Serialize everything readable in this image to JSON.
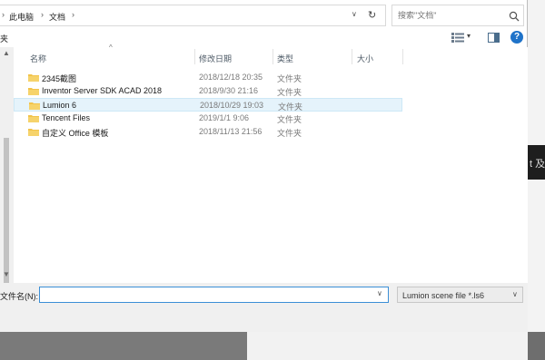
{
  "address": {
    "crumbs": [
      "此电脑",
      "文档"
    ],
    "search_placeholder": "搜索\"文档\""
  },
  "toolbar": {
    "new_folder_label": "夹"
  },
  "columns": {
    "name": "名称",
    "date": "修改日期",
    "type": "类型",
    "size": "大小"
  },
  "files": [
    {
      "name": "2345截图",
      "date": "2018/12/18 20:35",
      "type": "文件夹",
      "selected": false
    },
    {
      "name": "Inventor Server SDK ACAD 2018",
      "date": "2018/9/30 21:16",
      "type": "文件夹",
      "selected": false
    },
    {
      "name": "Lumion 6",
      "date": "2018/10/29 19:03",
      "type": "文件夹",
      "selected": true
    },
    {
      "name": "Tencent Files",
      "date": "2019/1/1 9:06",
      "type": "文件夹",
      "selected": false
    },
    {
      "name": "自定义 Office 模板",
      "date": "2018/11/13 21:56",
      "type": "文件夹",
      "selected": false
    }
  ],
  "footer": {
    "filename_label": "文件名(N):",
    "filename_value": "",
    "filter_value": "Lumion scene file *.ls6"
  },
  "background": {
    "partial_text": "t 及"
  },
  "colors": {
    "accent": "#1f73c9",
    "selection": "#e5f3fb",
    "folder": "#f2c34a"
  }
}
